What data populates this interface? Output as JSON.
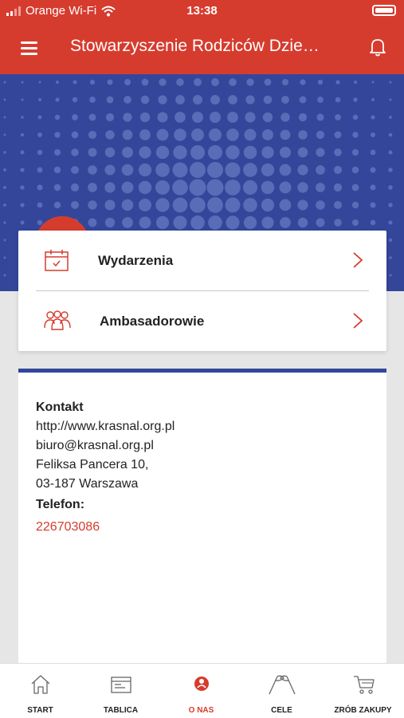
{
  "status_bar": {
    "carrier": "Orange Wi-Fi",
    "time": "13:38"
  },
  "header": {
    "title": "Stowarzyszenie Rodziców Dzie…"
  },
  "menu": {
    "items": [
      {
        "label": "Wydarzenia",
        "icon": "calendar-icon"
      },
      {
        "label": "Ambasadorowie",
        "icon": "people-icon"
      }
    ]
  },
  "contact": {
    "heading": "Kontakt",
    "website": "http://www.krasnal.org.pl",
    "email": "biuro@krasnal.org.pl",
    "address_line1": "Feliksa Pancera 10,",
    "address_line2": "03-187 Warszawa",
    "phone_label": "Telefon:",
    "phone": "226703086"
  },
  "tabs": [
    {
      "label": "START",
      "icon": "home-icon",
      "active": false
    },
    {
      "label": "TABLICA",
      "icon": "board-icon",
      "active": false
    },
    {
      "label": "O NAS",
      "icon": "emblem-icon",
      "active": true
    },
    {
      "label": "CELE",
      "icon": "flags-icon",
      "active": false
    },
    {
      "label": "ZRÓB ZAKUPY",
      "icon": "cart-icon",
      "active": false
    }
  ],
  "colors": {
    "brand_red": "#d63c2e",
    "brand_blue": "#34469a"
  }
}
